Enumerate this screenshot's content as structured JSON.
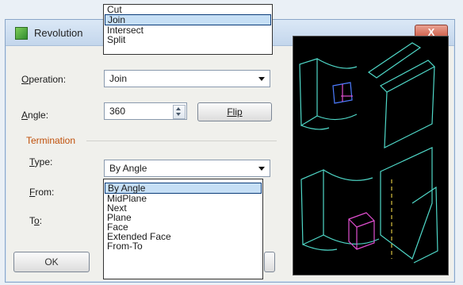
{
  "window": {
    "title": "Revolution",
    "close_label": "X"
  },
  "operation": {
    "label": "Operation:",
    "value": "Join",
    "menu": [
      "Cut",
      "Join",
      "Intersect",
      "Split"
    ],
    "selected_index": 1
  },
  "angle": {
    "label": "Angle:",
    "value": "360",
    "flip_label": "Flip"
  },
  "termination": {
    "group_label": "Termination",
    "type_label": "Type:",
    "type_value": "By Angle",
    "from_label": "From:",
    "to_label": "To:",
    "menu": [
      "By Angle",
      "MidPlane",
      "Next",
      "Plane",
      "Face",
      "Extended Face",
      "From-To"
    ],
    "selected_index": 0
  },
  "buttons": {
    "ok_label": "OK"
  },
  "colors": {
    "preview_background": "#000000",
    "wire": "#4fd8c8",
    "accent": "#c0500a"
  }
}
